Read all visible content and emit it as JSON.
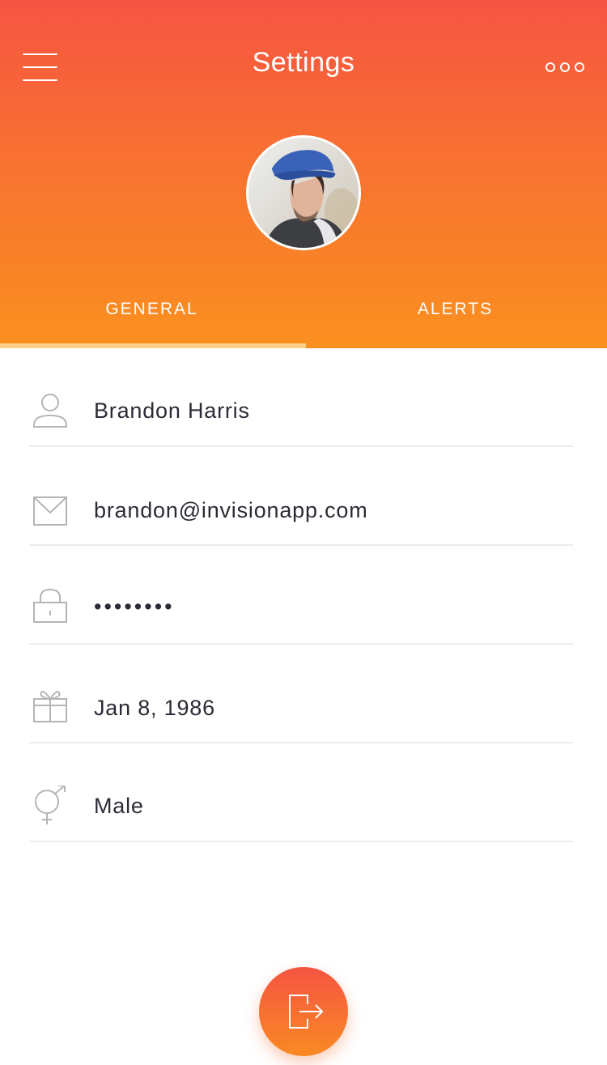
{
  "header": {
    "title": "Settings",
    "menu_icon": "hamburger-menu-icon",
    "more_icon": "more-options-icon",
    "gradient_top": "#f65442",
    "gradient_bottom": "#fa901f"
  },
  "tabs": [
    {
      "label": "GENERAL",
      "active": true
    },
    {
      "label": "ALERTS",
      "active": false
    }
  ],
  "fields": {
    "name": {
      "icon": "user-icon",
      "value": "Brandon Harris"
    },
    "email": {
      "icon": "mail-icon",
      "value": "brandon@invisionapp.com"
    },
    "password": {
      "icon": "lock-icon",
      "value": "••••••••"
    },
    "birthday": {
      "icon": "gift-icon",
      "value": "Jan 8, 1986"
    },
    "gender": {
      "icon": "gender-icon",
      "value": "Male"
    }
  },
  "logout": {
    "icon": "logout-icon"
  },
  "colors": {
    "accent": "#f8772e",
    "tab_indicator": "#fdd08a",
    "divider": "#ececec",
    "icon_gray": "#b5b5b5",
    "text": "#2b2b36"
  }
}
